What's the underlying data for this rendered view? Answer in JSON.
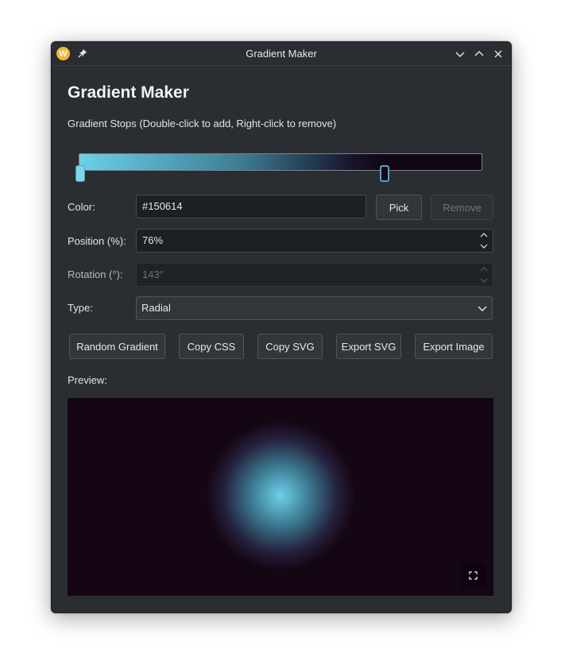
{
  "window": {
    "title": "Gradient Maker",
    "icons": [
      "app-logo-icon",
      "pin-icon",
      "minimize-icon",
      "maximize-icon",
      "close-icon"
    ]
  },
  "header": {
    "title": "Gradient Maker",
    "subtitle": "Gradient Stops (Double-click to add, Right-click to remove)"
  },
  "gradient": {
    "stops": [
      {
        "color": "#6cd0ea",
        "position": 0
      },
      {
        "color": "#150614",
        "position": 76
      }
    ],
    "selected_stop": 1
  },
  "form": {
    "color_label": "Color:",
    "color_value": "#150614",
    "pick_label": "Pick",
    "remove_label": "Remove",
    "position_label": "Position (%):",
    "position_value": "76%",
    "rotation_label": "Rotation (°):",
    "rotation_value": "143°",
    "type_label": "Type:",
    "type_value": "Radial"
  },
  "actions": {
    "random": "Random Gradient",
    "copy_css": "Copy CSS",
    "copy_svg": "Copy SVG",
    "export_svg": "Export SVG",
    "export_image": "Export Image"
  },
  "preview": {
    "label": "Preview:"
  },
  "colors": {
    "accent": "#4ea4d8",
    "stop_start": "#6cd0ea",
    "stop_end": "#150614",
    "logo": "#f2b632"
  }
}
